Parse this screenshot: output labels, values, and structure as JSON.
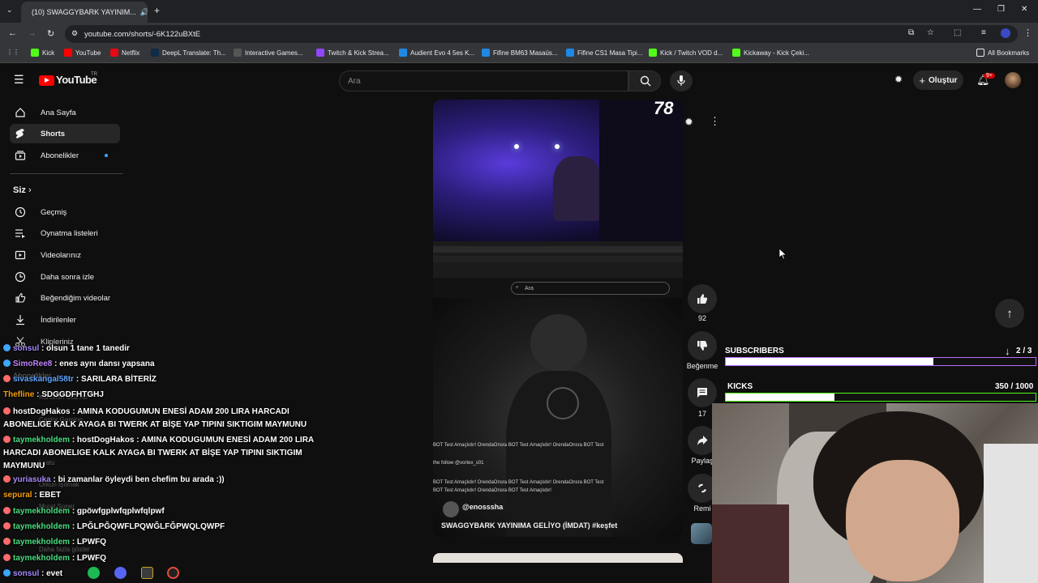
{
  "browser": {
    "tab_title": "(10) SWAGGYBARK YAYINIM...",
    "url": "youtube.com/shorts/-6K122uBXtE",
    "bookmarks": [
      "Kick",
      "YouTube",
      "Netflix",
      "DeepL Translate: Th...",
      "Interactive Games...",
      "Twitch & Kick Strea...",
      "Audient Evo 4 5es K...",
      "Fifine BM63 Masaüs...",
      "Fifine CS1 Masa Tipi...",
      "Kick / Twitch VOD d...",
      "Kickaway - Kick Çeki..."
    ],
    "all_bookmarks": "All Bookmarks"
  },
  "youtube": {
    "logo": "YouTube",
    "logo_region": "TR",
    "search_placeholder": "Ara",
    "create_label": "Oluştur",
    "notif_count": "9+",
    "sidebar": {
      "home": "Ana Sayfa",
      "shorts": "Shorts",
      "subs": "Abonelikler",
      "you": "Siz",
      "history": "Geçmiş",
      "playlists": "Oynatma listeleri",
      "videos": "Videolarınız",
      "watch_later": "Daha sonra izle",
      "liked": "Beğendiğim videolar",
      "downloads": "İndirilenler",
      "clips": "Klipleriniz"
    },
    "video": {
      "corner_number": "78",
      "inner_search": "Ara",
      "channel": "@enosssha",
      "title": "SWAGGYBARK YAYINIMA GELİYO (İMDAT) #keşfet",
      "overlay_lines": [
        "BOT Test Amaçlıdır! OrendaOnsra BOT Test Amaçlıdır! OrendaOnsra BOT Test",
        "the follow @vortex_s01",
        "BOT Test Amaçlıdır! OrendaOnsra BOT Test Amaçlıdır! OrendaOnsra BOT Test",
        "BOT Test Amaçlıdır! OrendaOnsra BOT Test Amaçlıdır!"
      ]
    },
    "actions": {
      "likes": "92",
      "dislike": "Beğenme",
      "comments": "17",
      "share": "Paylaş",
      "remix": "Remi"
    }
  },
  "overlay": {
    "subscribers_label": "SUBSCRIBERS",
    "subscribers_count": "2 / 3",
    "subscribers_progress": 0.67,
    "kicks_label": "KICKS",
    "kicks_count": "350 / 1000",
    "kicks_progress": 0.35
  },
  "chat": [
    {
      "user": "sonsul",
      "msg": ": olsun 1 tane 1 tanedir",
      "color": "#a78bfa"
    },
    {
      "user": "SimoRee8",
      "msg": ": enes aynı dansı yapsana",
      "color": "#c084fc"
    },
    {
      "user": "sivaskangal58tr",
      "msg": ": SARILARA BİTERİZ",
      "color": "#60a5fa"
    },
    {
      "user": "Thefline",
      "msg": ": SDGGDFHTGHJ",
      "color": "#f59e0b"
    },
    {
      "user": "hostDogHakos",
      "msg": ": AMINA KODUGUMUN ENESİ ADAM 200 LIRA HARCADI ABONELIGE KALK AYAGA BI TWERK AT BİŞE YAP TIPINI SIKTIGIM MAYMUNU",
      "color": "#f1f1f1"
    },
    {
      "user": "taymekholdem",
      "msg": ": hostDogHakos : AMINA KODUGUMUN ENESİ ADAM 200 LIRA HARCADI ABONELIGE KALK AYAGA BI TWERK AT BİŞE YAP TIPINI SIKTIGIM MAYMUNU",
      "color": "#4ade80"
    },
    {
      "user": "yuriasuka",
      "msg": ": bi zamanlar öyleydi ben chefim bu arada :))",
      "color": "#a78bfa"
    },
    {
      "user": "sepural",
      "msg": ": EBET",
      "color": "#f59e0b"
    },
    {
      "user": "taymekholdem",
      "msg": ": gpöwfgplwfqplwfqlpwf",
      "color": "#4ade80"
    },
    {
      "user": "taymekholdem",
      "msg": ": LPĞLPĞQWFLPQWĞLFĞPWQLQWPF",
      "color": "#4ade80"
    },
    {
      "user": "taymekholdem",
      "msg": ": LPWFQ",
      "color": "#4ade80"
    },
    {
      "user": "taymekholdem",
      "msg": ": LPWFQ",
      "color": "#4ade80"
    },
    {
      "user": "sonsul",
      "msg": ": evet",
      "color": "#a78bfa"
    }
  ],
  "ghost_sidebar": [
    "Abonelikler",
    "Kanalları Göz Atı",
    "Castor Gaming",
    "Lcatu",
    "Orkun Işıtmak",
    "Murat Soner",
    "Daha fazla göster"
  ]
}
